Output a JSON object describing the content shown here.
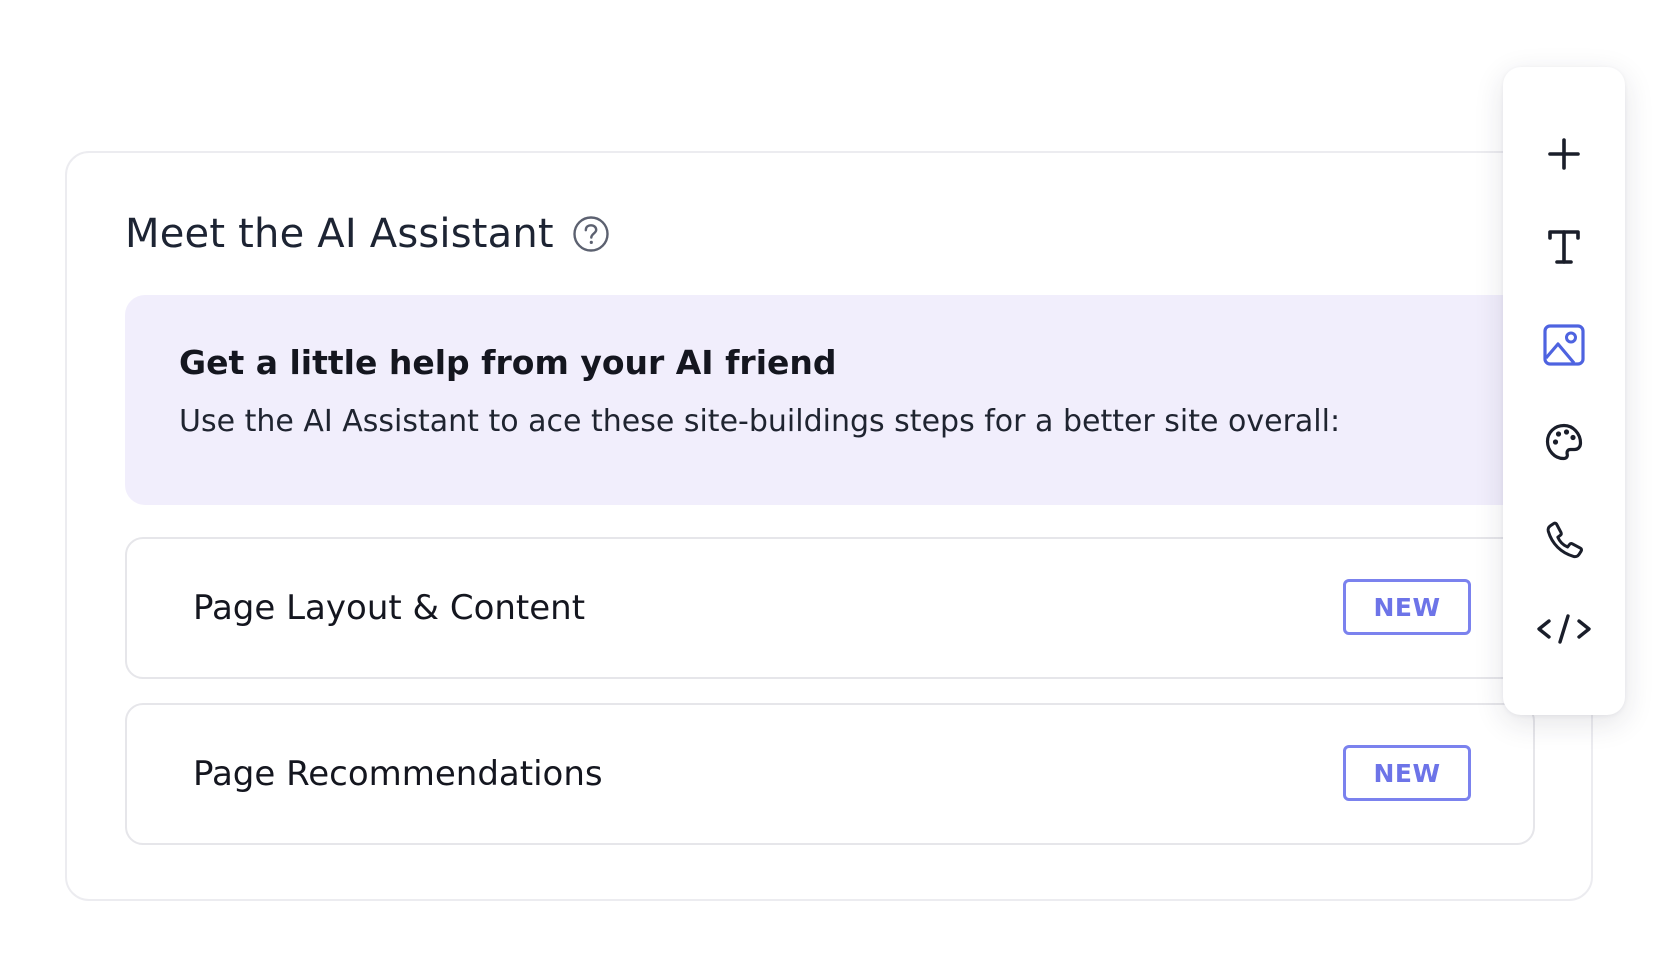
{
  "card": {
    "title": "Meet the AI Assistant",
    "help_icon": "question-circle-icon"
  },
  "intro": {
    "heading": "Get a little help from your AI friend",
    "text": "Use the AI Assistant to ace these site-buildings steps for a better site overall:"
  },
  "features": [
    {
      "label": "Page Layout & Content",
      "badge": "NEW"
    },
    {
      "label": "Page Recommendations",
      "badge": "NEW"
    }
  ],
  "toolbar": {
    "items": [
      {
        "icon": "plus-icon",
        "active": false
      },
      {
        "icon": "text-icon",
        "active": false
      },
      {
        "icon": "image-icon",
        "active": true
      },
      {
        "icon": "palette-icon",
        "active": false
      },
      {
        "icon": "phone-icon",
        "active": false
      },
      {
        "icon": "code-icon",
        "active": false
      }
    ]
  },
  "colors": {
    "accent": "#5a6ce0",
    "badge": "#7b82ee",
    "intro_background": "#f1eefc",
    "text_dark": "#1d2433"
  }
}
